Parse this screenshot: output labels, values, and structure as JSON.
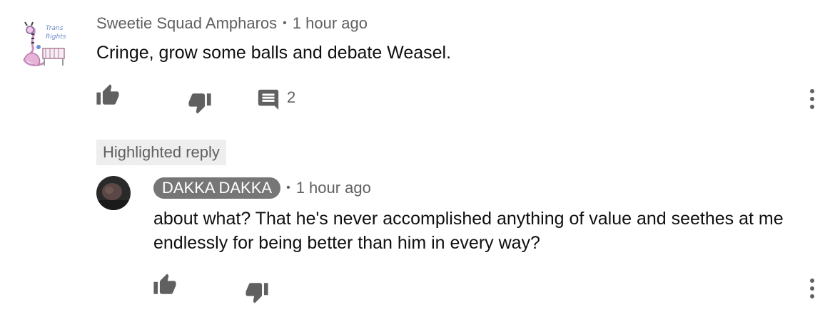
{
  "comment": {
    "author": "Sweetie Squad Ampharos",
    "separator": "•",
    "time": "1 hour ago",
    "text": "Cringe, grow some balls and debate Weasel.",
    "avatar_caption": [
      "Trans",
      "Rights"
    ],
    "reply_count": "2",
    "icons": {
      "like": "thumbs-up-icon",
      "dislike": "thumbs-down-icon",
      "replies": "comment-icon",
      "more": "more-vert-icon"
    }
  },
  "highlighted_reply": {
    "badge": "Highlighted reply",
    "author": "DAKKA DAKKA",
    "separator": "•",
    "time": "1 hour ago",
    "text": "about what? That he's never accomplished anything of value and seethes at me endlessly for being better than him in every way?",
    "icons": {
      "like": "thumbs-up-icon",
      "dislike": "thumbs-down-icon",
      "more": "more-vert-icon"
    }
  },
  "colors": {
    "text_primary": "#0f0f0f",
    "text_secondary": "#606060",
    "author_pill_bg": "#767676",
    "badge_bg": "#eeeeee"
  }
}
